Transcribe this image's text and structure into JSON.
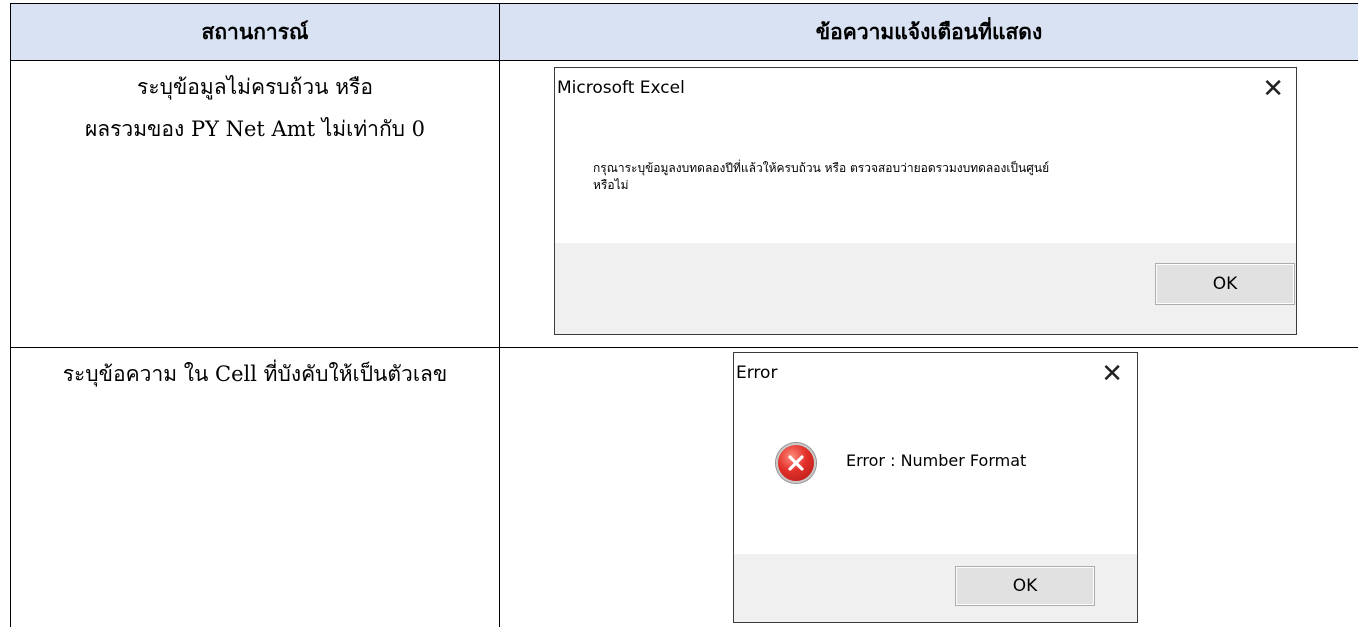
{
  "table": {
    "headers": [
      "สถานการณ์",
      "ข้อความแจ้งเตือนที่แสดง"
    ],
    "rows": [
      {
        "scenario_lines": [
          "ระบุข้อมูลไม่ครบถ้วน หรือ",
          "ผลรวมของ PY Net Amt ไม่เท่ากับ 0"
        ],
        "dialog": {
          "title": "Microsoft Excel",
          "message_lines": [
            "กรุณาระบุข้อมูลงบทดลองปีที่แล้วให้ครบถ้วน หรือ ตรวจสอบว่ายอดรวมงบทดลองเป็นศูนย์",
            "หรือไม่"
          ],
          "ok_label": "OK",
          "close_glyph": "✕"
        }
      },
      {
        "scenario_lines": [
          "ระบุข้อความ ใน Cell ที่บังคับให้เป็นตัวเลข"
        ],
        "dialog": {
          "title": "Error",
          "message": "Error : Number Format",
          "icon": "error-icon",
          "ok_label": "OK",
          "close_glyph": "✕"
        }
      }
    ]
  },
  "colors": {
    "header_bg": "#d9e2f3",
    "dialog_footer": "#f0f0f0",
    "button_bg": "#e1e1e1",
    "error_red": "#e2302a"
  }
}
